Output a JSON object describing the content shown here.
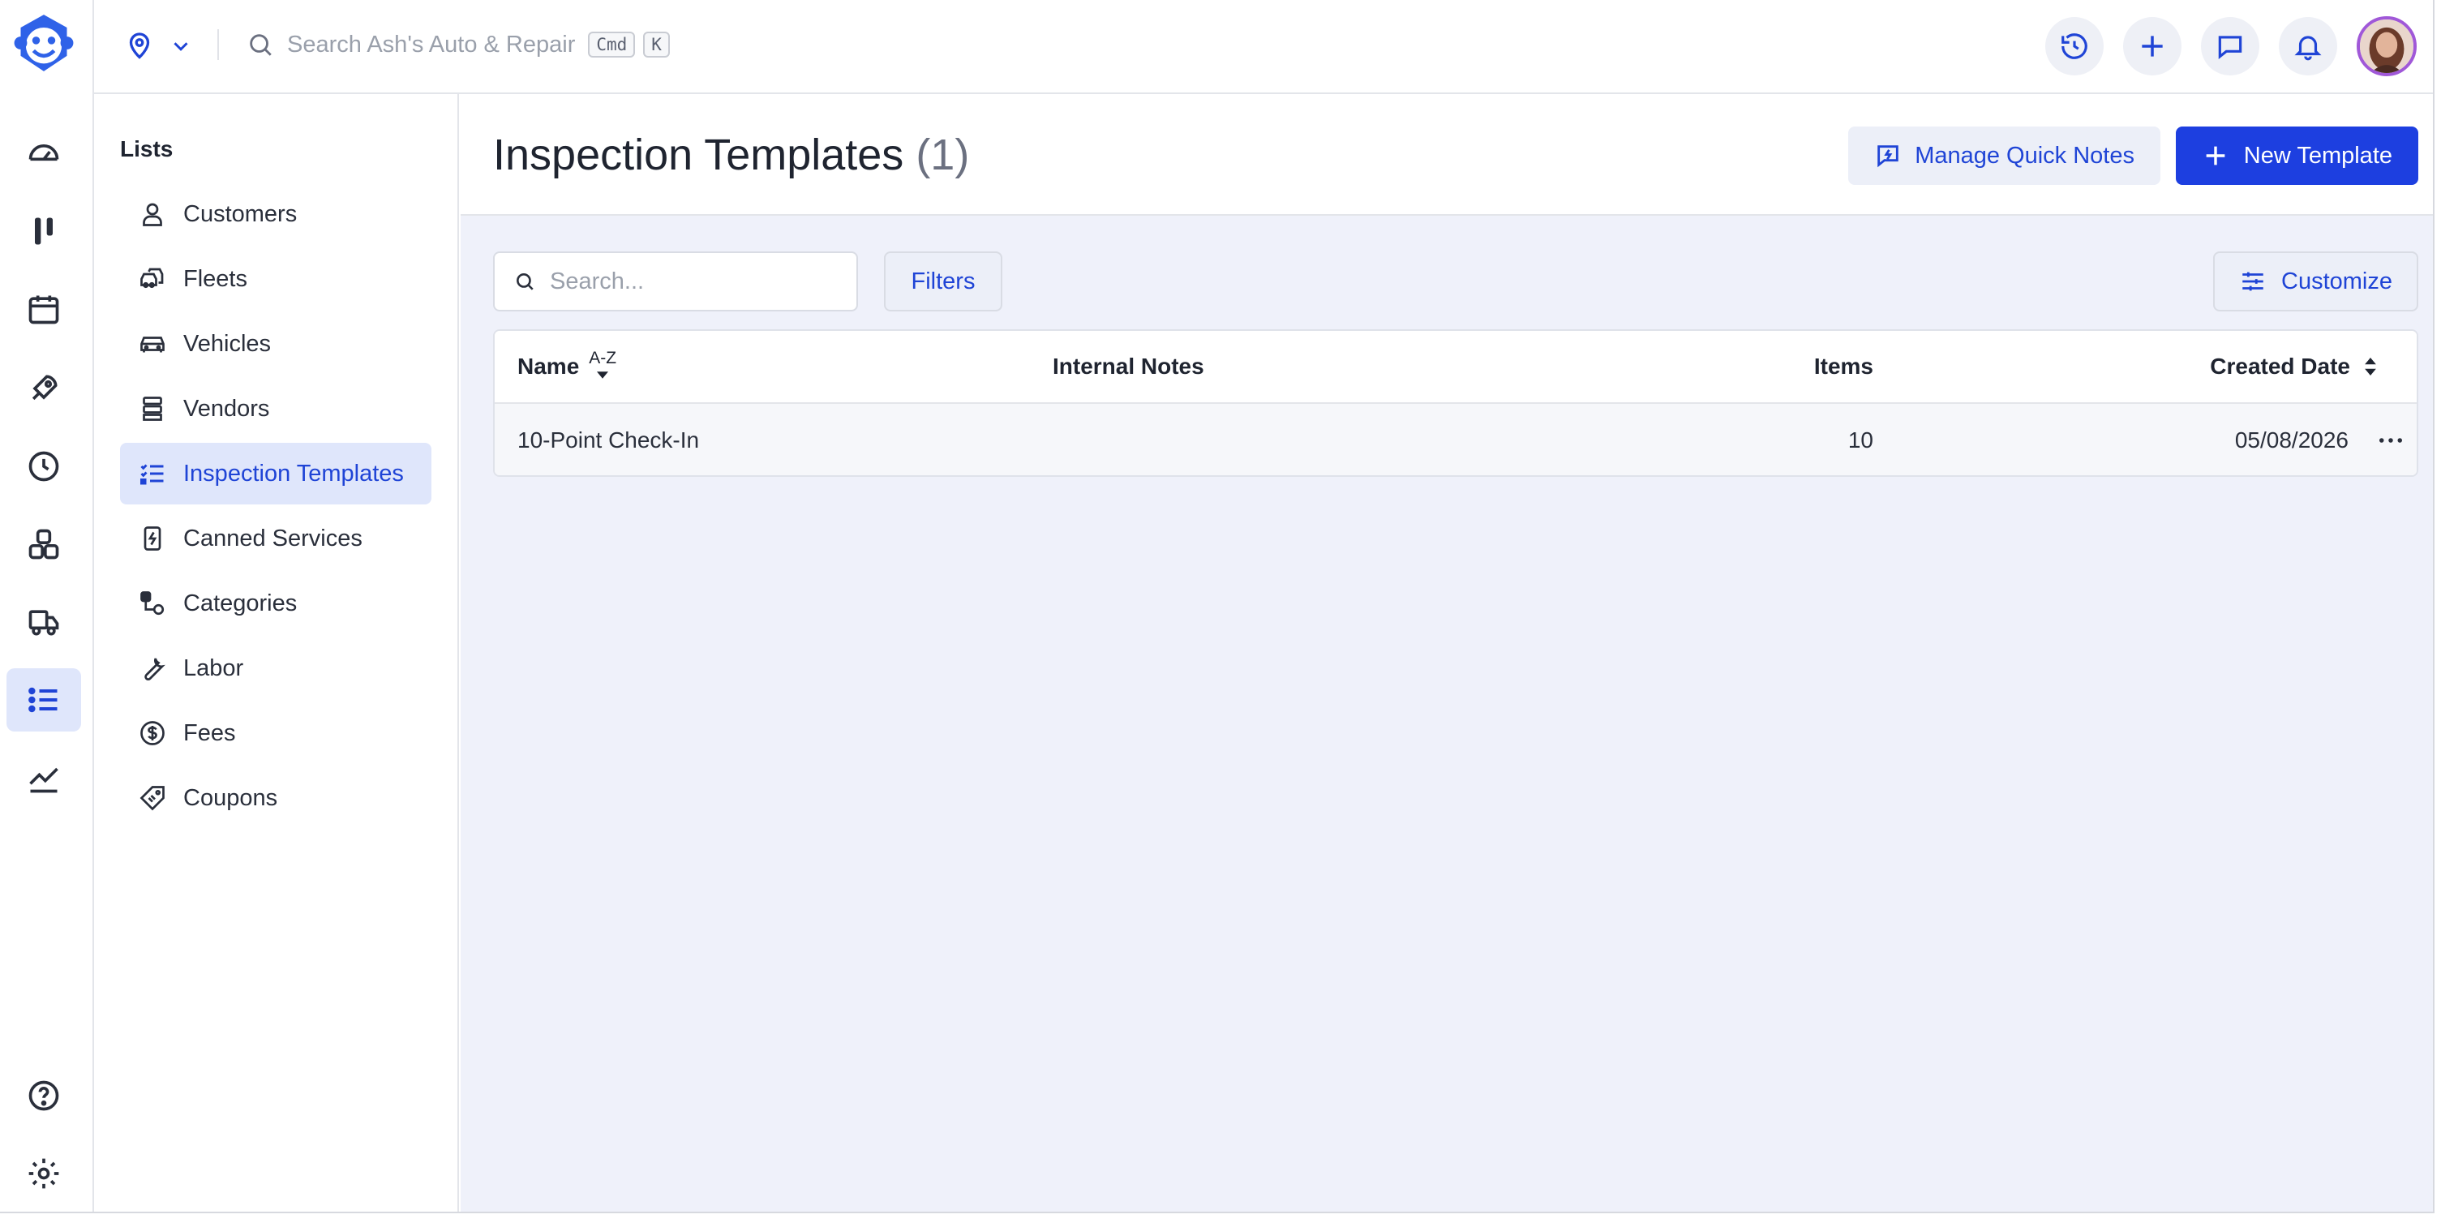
{
  "topbar": {
    "search_placeholder": "Search Ash's Auto & Repair",
    "shortcut_key1": "Cmd",
    "shortcut_key2": "K"
  },
  "lists_nav": {
    "title": "Lists",
    "items": [
      {
        "label": "Customers",
        "icon": "person-icon"
      },
      {
        "label": "Fleets",
        "icon": "fleet-icon"
      },
      {
        "label": "Vehicles",
        "icon": "car-icon"
      },
      {
        "label": "Vendors",
        "icon": "vendor-icon"
      },
      {
        "label": "Inspection Templates",
        "icon": "checklist-icon",
        "active": true
      },
      {
        "label": "Canned Services",
        "icon": "canned-services-icon"
      },
      {
        "label": "Categories",
        "icon": "categories-icon"
      },
      {
        "label": "Labor",
        "icon": "wrench-icon"
      },
      {
        "label": "Fees",
        "icon": "dollar-icon"
      },
      {
        "label": "Coupons",
        "icon": "coupon-icon"
      }
    ]
  },
  "page": {
    "title": "Inspection Templates",
    "count": "(1)",
    "manage_quick_notes_label": "Manage Quick Notes",
    "new_template_label": "New Template"
  },
  "toolbar": {
    "search_placeholder": "Search...",
    "filters_label": "Filters",
    "customize_label": "Customize"
  },
  "table": {
    "columns": {
      "name": "Name",
      "name_sort": "A-Z",
      "internal_notes": "Internal Notes",
      "items": "Items",
      "created_date": "Created Date"
    },
    "rows": [
      {
        "name": "10-Point Check-In",
        "internal_notes": "",
        "items": "10",
        "created_date": "05/08/2026"
      }
    ]
  },
  "colors": {
    "accent": "#1d3fe0",
    "active_bg": "#dfe6fb",
    "main_bg": "#eff1fa"
  }
}
